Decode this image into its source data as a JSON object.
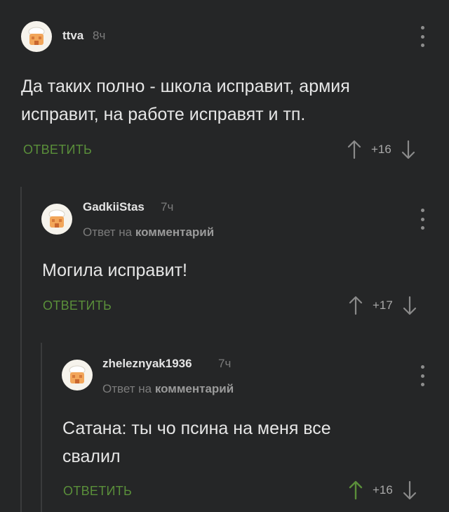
{
  "comments": [
    {
      "author": "ttva",
      "time": "8ч",
      "text_line1": "Да таких полно - школа исправит, армия",
      "text_line2": "исправит, на работе исправят и тп.",
      "reply_label": "ОТВЕТИТЬ",
      "score": "+16"
    },
    {
      "author": "GadkiiStas",
      "time": "7ч",
      "reply_prefix": "Ответ на",
      "reply_target": "комментарий",
      "text_line1": "Могила исправит!",
      "reply_label": "ОТВЕТИТЬ",
      "score": "+17"
    },
    {
      "author": "zheleznyak1936",
      "time": "7ч",
      "reply_prefix": "Ответ на",
      "reply_target": "комментарий",
      "text_line1": "Сатана: ты чо псина на меня все",
      "text_line2": "свалил",
      "reply_label": "ОТВЕТИТЬ",
      "score": "+16"
    }
  ],
  "colors": {
    "background": "#252627",
    "reply_green": "#5a8f3a",
    "upvote_active": "#5a8f3a",
    "muted": "#7c7c7c"
  },
  "icons": [
    "avatar-icon",
    "kebab-menu-icon",
    "arrow-up-icon",
    "arrow-down-icon"
  ]
}
